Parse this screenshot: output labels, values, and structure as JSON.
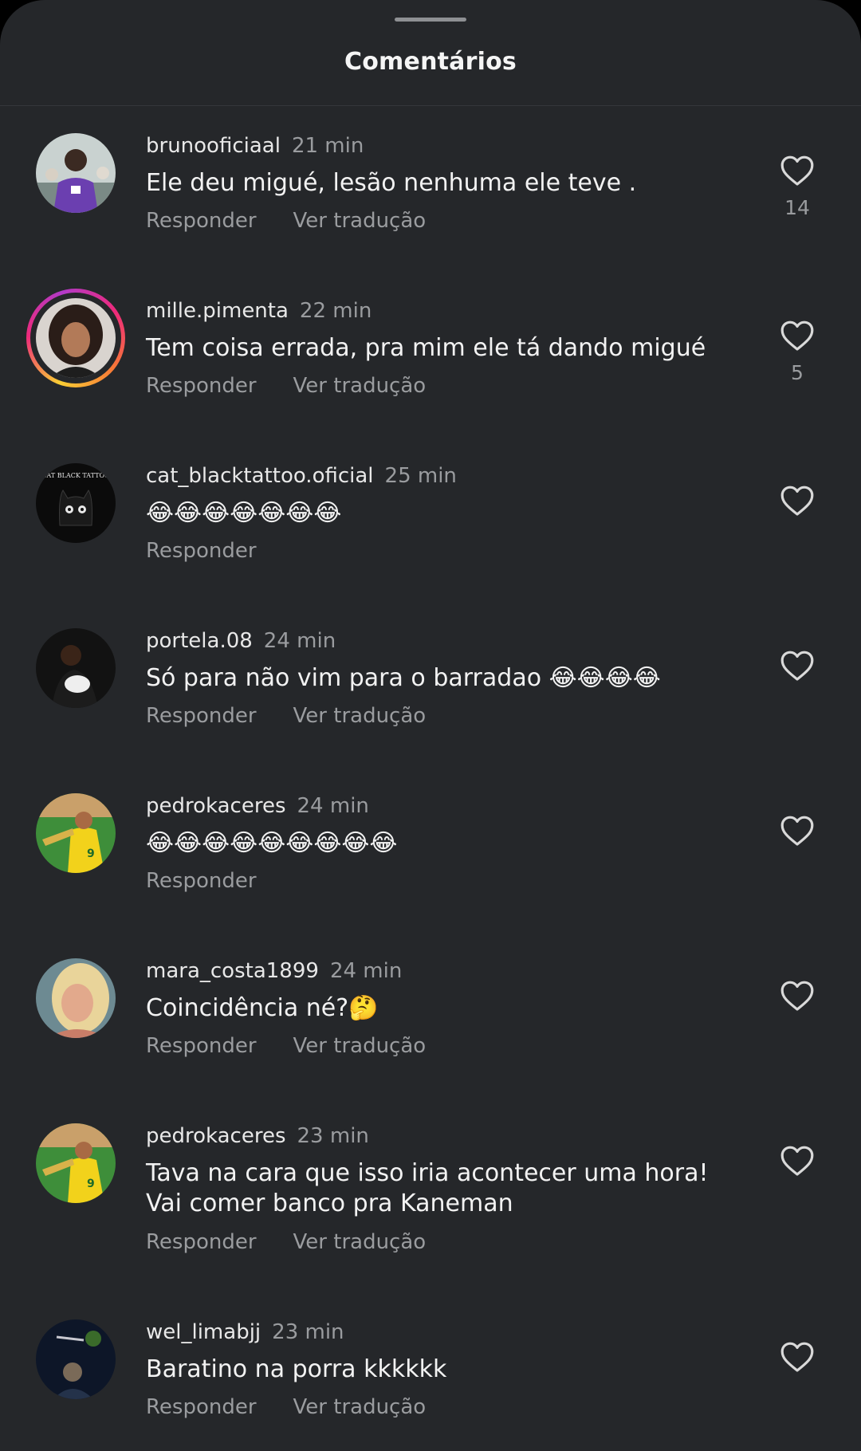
{
  "header": {
    "title": "Comentários"
  },
  "labels": {
    "reply": "Responder",
    "translate": "Ver tradução"
  },
  "comments": [
    {
      "user": "brunooficiaal",
      "time": "21 min",
      "text": "Ele deu migué, lesão nenhuma ele teve .",
      "likes": "14"
    },
    {
      "user": "mille.pimenta",
      "time": "22 min",
      "text": "Tem coisa errada, pra mim ele tá dando migué",
      "likes": "5"
    },
    {
      "user": "cat_blacktattoo.oficial",
      "time": "25 min",
      "text": "😂😂😂😂😂😂😂",
      "likes": ""
    },
    {
      "user": "portela.08",
      "time": "24 min",
      "text": "Só para não vim para o barradao 😂😂😂😂",
      "likes": ""
    },
    {
      "user": "pedrokaceres",
      "time": "24 min",
      "text": "😂😂😂😂😂😂😂😂😂",
      "likes": ""
    },
    {
      "user": "mara_costa1899",
      "time": "24 min",
      "text": "Coincidência né?🤔",
      "likes": ""
    },
    {
      "user": "pedrokaceres",
      "time": "23 min",
      "text": "Tava na cara que isso iria acontecer uma hora! Vai comer banco pra Kaneman",
      "likes": ""
    },
    {
      "user": "wel_limabjj",
      "time": "23 min",
      "text": "Baratino na porra kkkkkk",
      "likes": ""
    }
  ],
  "avatar_logo_text": "CAT BLACK TATTOO",
  "colors": {
    "background": "#25272a",
    "text": "#f2f2f2",
    "muted": "#9a9c9f"
  }
}
